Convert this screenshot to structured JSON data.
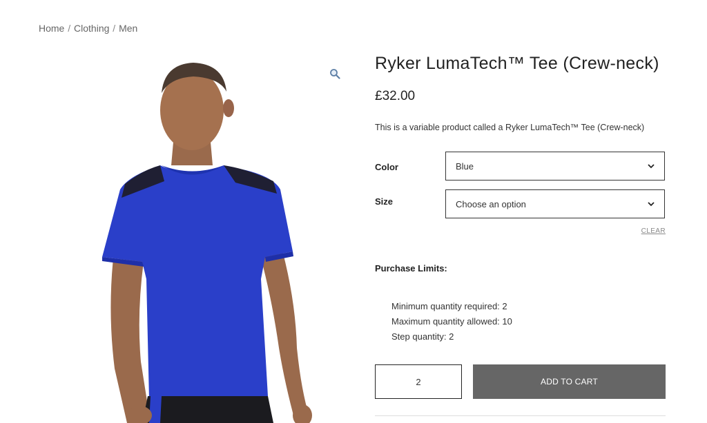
{
  "breadcrumb": {
    "home": "Home",
    "category": "Clothing",
    "subcategory": "Men",
    "separator": "/"
  },
  "product": {
    "title": "Ryker LumaTech™ Tee (Crew-neck)",
    "price": "£32.00",
    "description": "This is a variable product called a Ryker LumaTech™ Tee (Crew-neck)",
    "image_alt": "Man wearing blue crew-neck t-shirt"
  },
  "variations": {
    "color": {
      "label": "Color",
      "selected": "Blue"
    },
    "size": {
      "label": "Size",
      "selected": "Choose an option"
    },
    "clear_label": "CLEAR"
  },
  "purchase_limits": {
    "title": "Purchase Limits:",
    "min": "Minimum quantity required: 2",
    "max": "Maximum quantity allowed: 10",
    "step": "Step quantity: 2"
  },
  "cart": {
    "quantity": "2",
    "add_label": "ADD TO CART"
  },
  "colors": {
    "shirt": "#2a3fc9",
    "button": "#666666"
  },
  "icons": {
    "zoom": "magnifier-icon",
    "chevron": "chevron-down-icon"
  }
}
